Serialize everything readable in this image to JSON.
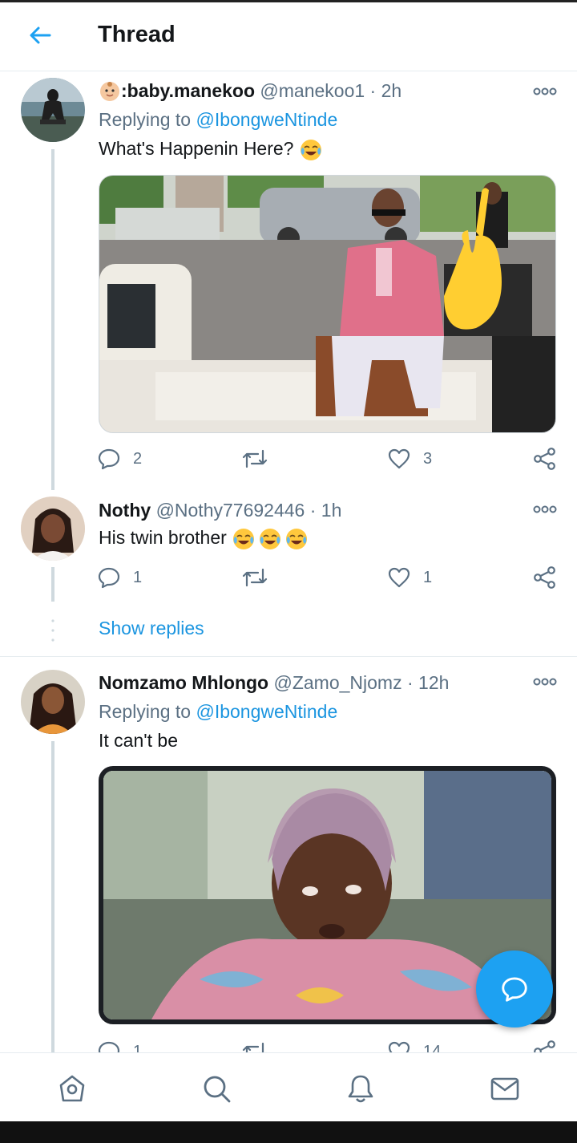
{
  "header": {
    "title": "Thread"
  },
  "tweets": [
    {
      "name": ":baby.manekoo",
      "handle": "@manekoo1",
      "time": "2h",
      "replying_label": "Replying to",
      "replying_to": "@IbongweNtinde",
      "text": "What's Happenin Here?",
      "emoji": "face-with-tears-of-joy",
      "media": "photo of man in pink suit sitting on chair on back of truck",
      "counts": {
        "replies": "2",
        "retweets": "",
        "likes": "3"
      }
    },
    {
      "name": "Nothy",
      "handle": "@Nothy77692446",
      "time": "1h",
      "text": "His twin brother",
      "emoji": "face-with-tears-of-joy x3",
      "counts": {
        "replies": "1",
        "retweets": "",
        "likes": "1"
      }
    },
    {
      "name": "Nomzamo Mhlongo",
      "handle": "@Zamo_Njomz",
      "time": "12h",
      "replying_label": "Replying to",
      "replying_to": "@IbongweNtinde",
      "text": "It can't be",
      "media": "photo of woman in headscarf looking puzzled",
      "counts": {
        "replies": "1",
        "retweets": "",
        "likes": "14"
      }
    }
  ],
  "show_replies": "Show replies",
  "separator": "·",
  "colors": {
    "accent": "#1da1f2",
    "link": "#1b95e0",
    "muted": "#5b7083"
  },
  "nav": [
    "home-icon",
    "search-icon",
    "notifications-icon",
    "messages-icon"
  ]
}
